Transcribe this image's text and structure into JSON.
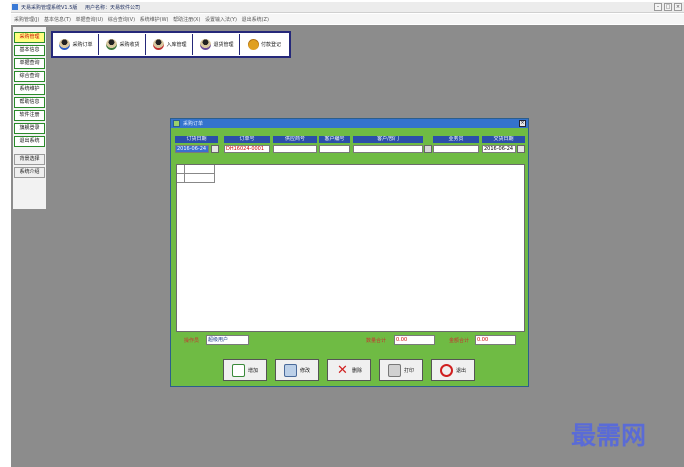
{
  "window": {
    "title": "天易采购管理系统V1.5版",
    "company": "用户名称：天易软件公司"
  },
  "menu": [
    "采购管理(J)",
    "基本信息(T)",
    "单据查询(U)",
    "综合查询(V)",
    "系统维护(W)",
    "帮助注册(X)",
    "设置输入法(Y)",
    "退出系统(Z)"
  ],
  "nav": [
    "采购管理",
    "基本信息",
    "单据查询",
    "综合查询",
    "系统维护",
    "帮助信息",
    "软件注册",
    "旗舰登录",
    "退出系统"
  ],
  "nav_extra": [
    "背景选择",
    "系统介绍"
  ],
  "toolbar": [
    {
      "label": "采购订单",
      "icon": "person-cart-icon"
    },
    {
      "label": "采购收货",
      "icon": "person-receive-icon"
    },
    {
      "label": "入库管理",
      "icon": "person-stock-in-icon"
    },
    {
      "label": "退货管理",
      "icon": "person-return-icon"
    },
    {
      "label": "付款登记",
      "icon": "money-bag-icon"
    }
  ],
  "dialog": {
    "title": "采购订单",
    "headers": [
      "订货日期",
      "订单号",
      "供应商号",
      "客户编号",
      "客户/部门",
      "业务员",
      "交货日期"
    ],
    "order_date": "2016-06-24",
    "order_no": "DH16024-0001",
    "supplier_no": "",
    "customer_no": "",
    "customer_dept": "",
    "salesperson": "",
    "delivery_date": "2016-06-24",
    "operator_label": "操作员",
    "operator": "超级用户",
    "qty_total_label": "数量合计",
    "qty_total": "0.00",
    "amount_total_label": "金额合计",
    "amount_total": "0.00",
    "buttons": [
      "增加",
      "修改",
      "删除",
      "打印",
      "退出"
    ]
  },
  "watermark": "最需网",
  "colors": {
    "workspace": "#8c8c8c",
    "dialog_bg": "#6fbb44",
    "dialog_title": "#3473cc",
    "header_cells": "#2b4faa",
    "toolbar_border": "#25287a",
    "nav_active": "#ffff80",
    "watermark": "#5a6bd6"
  }
}
